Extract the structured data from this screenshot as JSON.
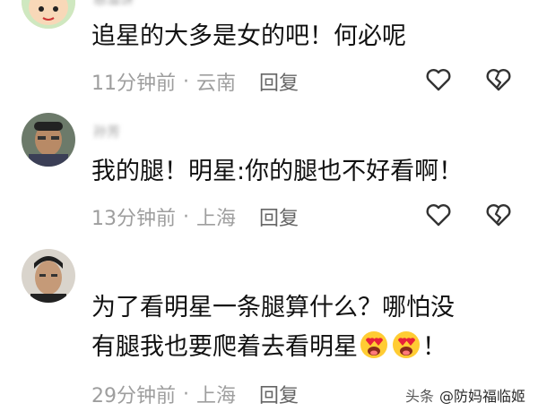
{
  "comments": [
    {
      "username": "慈溢饼",
      "text": "追星的大多是女的吧！何必呢",
      "time": "11分钟前",
      "location": "云南",
      "reply": "回复",
      "avatar": "cartoon-avatar"
    },
    {
      "username": "孙芳",
      "text": "我的腿！明星:你的腿也不好看啊！",
      "time": "13分钟前",
      "location": "上海",
      "reply": "回复",
      "avatar": "photo-avatar"
    },
    {
      "username": "",
      "line1": "为了看明星一条腿算什么？哪怕没",
      "line2": "有腿我也要爬着去看明星",
      "line2_end": "！",
      "emojis": [
        "heart-eyes-emoji",
        "heart-eyes-emoji"
      ],
      "time": "29分钟前",
      "location": "上海",
      "reply": "回复",
      "avatar": "photo-avatar"
    }
  ],
  "separator": "·",
  "icons": {
    "like": "heart-outline-icon",
    "dislike": "broken-heart-icon"
  },
  "watermark": {
    "prefix": "头条",
    "name": "@防妈福临姬"
  }
}
